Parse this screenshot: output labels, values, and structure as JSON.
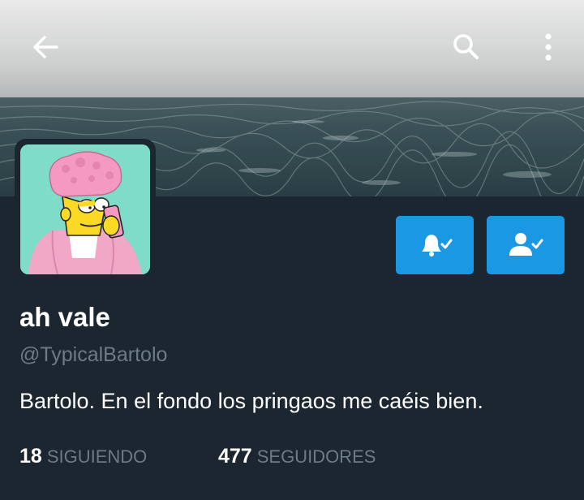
{
  "colors": {
    "background": "#1b2631",
    "accent": "#1a98e4",
    "muted_text": "#6d7b86"
  },
  "top_bar": {
    "back_icon": "arrow-left-icon",
    "search_icon": "search-icon",
    "menu_icon": "more-vertical-icon"
  },
  "profile": {
    "display_name": "ah vale",
    "handle": "@TypicalBartolo",
    "bio": "Bartolo. En el fondo los pringaos me caéis bien."
  },
  "actions": {
    "notifications_icon": "bell-check-icon",
    "follow_icon": "person-check-icon"
  },
  "stats": {
    "following_count": "18",
    "following_label": "SIGUIENDO",
    "followers_count": "477",
    "followers_label": "SEGUIDORES"
  }
}
